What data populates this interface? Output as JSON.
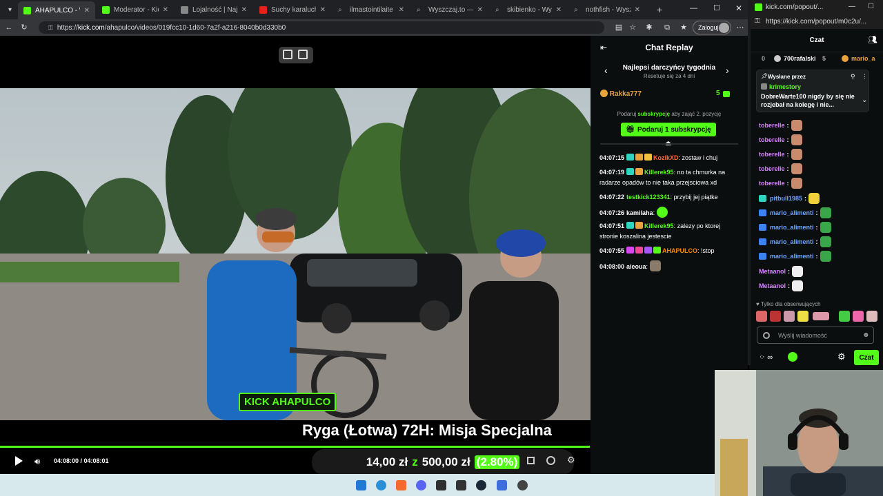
{
  "main_window": {
    "tabs": [
      {
        "label": "AHAPULCO - Watch l",
        "active": true
      },
      {
        "label": "Moderator - Kick Da"
      },
      {
        "label": "Lojalność | Najlepsze"
      },
      {
        "label": "Suchy karaluch - cyp"
      },
      {
        "label": "ilmastointilaite - Wys"
      },
      {
        "label": "Wyszczaj.to — znajd"
      },
      {
        "label": "skibienko - Wyszukaj"
      },
      {
        "label": "nothfish - Wyszukaj"
      }
    ],
    "url_prefix": "https://",
    "url_host": "kick.com",
    "url_path": "/ahapulco/videos/019fcc10-1d60-7a2f-a216-8040b0d330b0",
    "login_label": "Zaloguj"
  },
  "video": {
    "title": "Ryga (Łotwa) 72H: Misja Specjalna",
    "time": "04:08:00 / 04:08:01",
    "progress": 0.999,
    "watermark": "KICK AHAPULCO",
    "donation": {
      "current": "14,00 zł",
      "sep": "z",
      "goal": "500,00 zł",
      "pct": "(2.80%)"
    }
  },
  "replay": {
    "title": "Chat Replay",
    "gifters_title": "Najlepsi darczyńcy tygodnia",
    "gifters_sub": "Resetuje się za 4 dni",
    "top_gifter": {
      "name": "Rakka777",
      "count": "5"
    },
    "gift_prompt_pre": "Podaruj",
    "gift_prompt_link": "subskrypcję",
    "gift_prompt_post": "aby zająć 2. pozycję",
    "gift_button": "Podaruj 1 subskrypcję",
    "messages": [
      {
        "time": "04:07:15",
        "user": "KozikXD",
        "color": "#ff6a3d",
        "text": ": zostaw i chuj"
      },
      {
        "time": "04:07:19",
        "user": "Killerek95",
        "color": "#53fc18",
        "text": ": no ta chmurka na radarze opadów to nie taka przejsciowa xd"
      },
      {
        "time": "04:07:22",
        "user": "testkick123341",
        "color": "#53fc18",
        "text": ": przybij jej piątke"
      },
      {
        "time": "04:07:26",
        "user": "kamilaha",
        "color": "#ffffff",
        "text": ":"
      },
      {
        "time": "04:07:51",
        "user": "Killerek95",
        "color": "#53fc18",
        "text": ": zalezy po ktorej stronie koszalina jestescie"
      },
      {
        "time": "04:07:55",
        "user": "AHAPULCO",
        "color": "#ff8c00",
        "text": ": !stop"
      },
      {
        "time": "04:08:00",
        "user": "aieoua",
        "color": "#ffffff",
        "text": ":"
      }
    ]
  },
  "popout": {
    "tab_label": "kick.com/popout/...",
    "url": "https://kick.com/popout/m0c2u/...",
    "header": "Czat",
    "leader_1": {
      "name": "700rafalski",
      "count": "5"
    },
    "leader_2": {
      "name": "mario_a"
    },
    "pinned_label": "Wysłane przez",
    "pinned_user": "krimestory",
    "pinned_text": "DobreWarte100 nigdy by się nie rozjebał na kolegę i nie...",
    "chat": [
      {
        "user": "toberelle",
        "color": "#d883ff"
      },
      {
        "user": "toberelle",
        "color": "#d883ff"
      },
      {
        "user": "toberelle",
        "color": "#d883ff"
      },
      {
        "user": "toberelle",
        "color": "#d883ff"
      },
      {
        "user": "toberelle",
        "color": "#d883ff"
      },
      {
        "user": "pitbull1985",
        "color": "#6fa8ff"
      },
      {
        "user": "mario_alimenti",
        "color": "#6fa8ff"
      },
      {
        "user": "mario_alimenti",
        "color": "#6fa8ff"
      },
      {
        "user": "mario_alimenti",
        "color": "#6fa8ff"
      },
      {
        "user": "mario_alimenti",
        "color": "#6fa8ff"
      },
      {
        "user": "Metaanol",
        "color": "#d883ff"
      },
      {
        "user": "Metaanol",
        "color": "#d883ff"
      }
    ],
    "follow_only": "Tylko dla obserwujących",
    "input_placeholder": "Wyślij wiadomość",
    "send_button": "Czat"
  },
  "colors": {
    "accent": "#53fc18",
    "bg": "#0b0e0f"
  }
}
